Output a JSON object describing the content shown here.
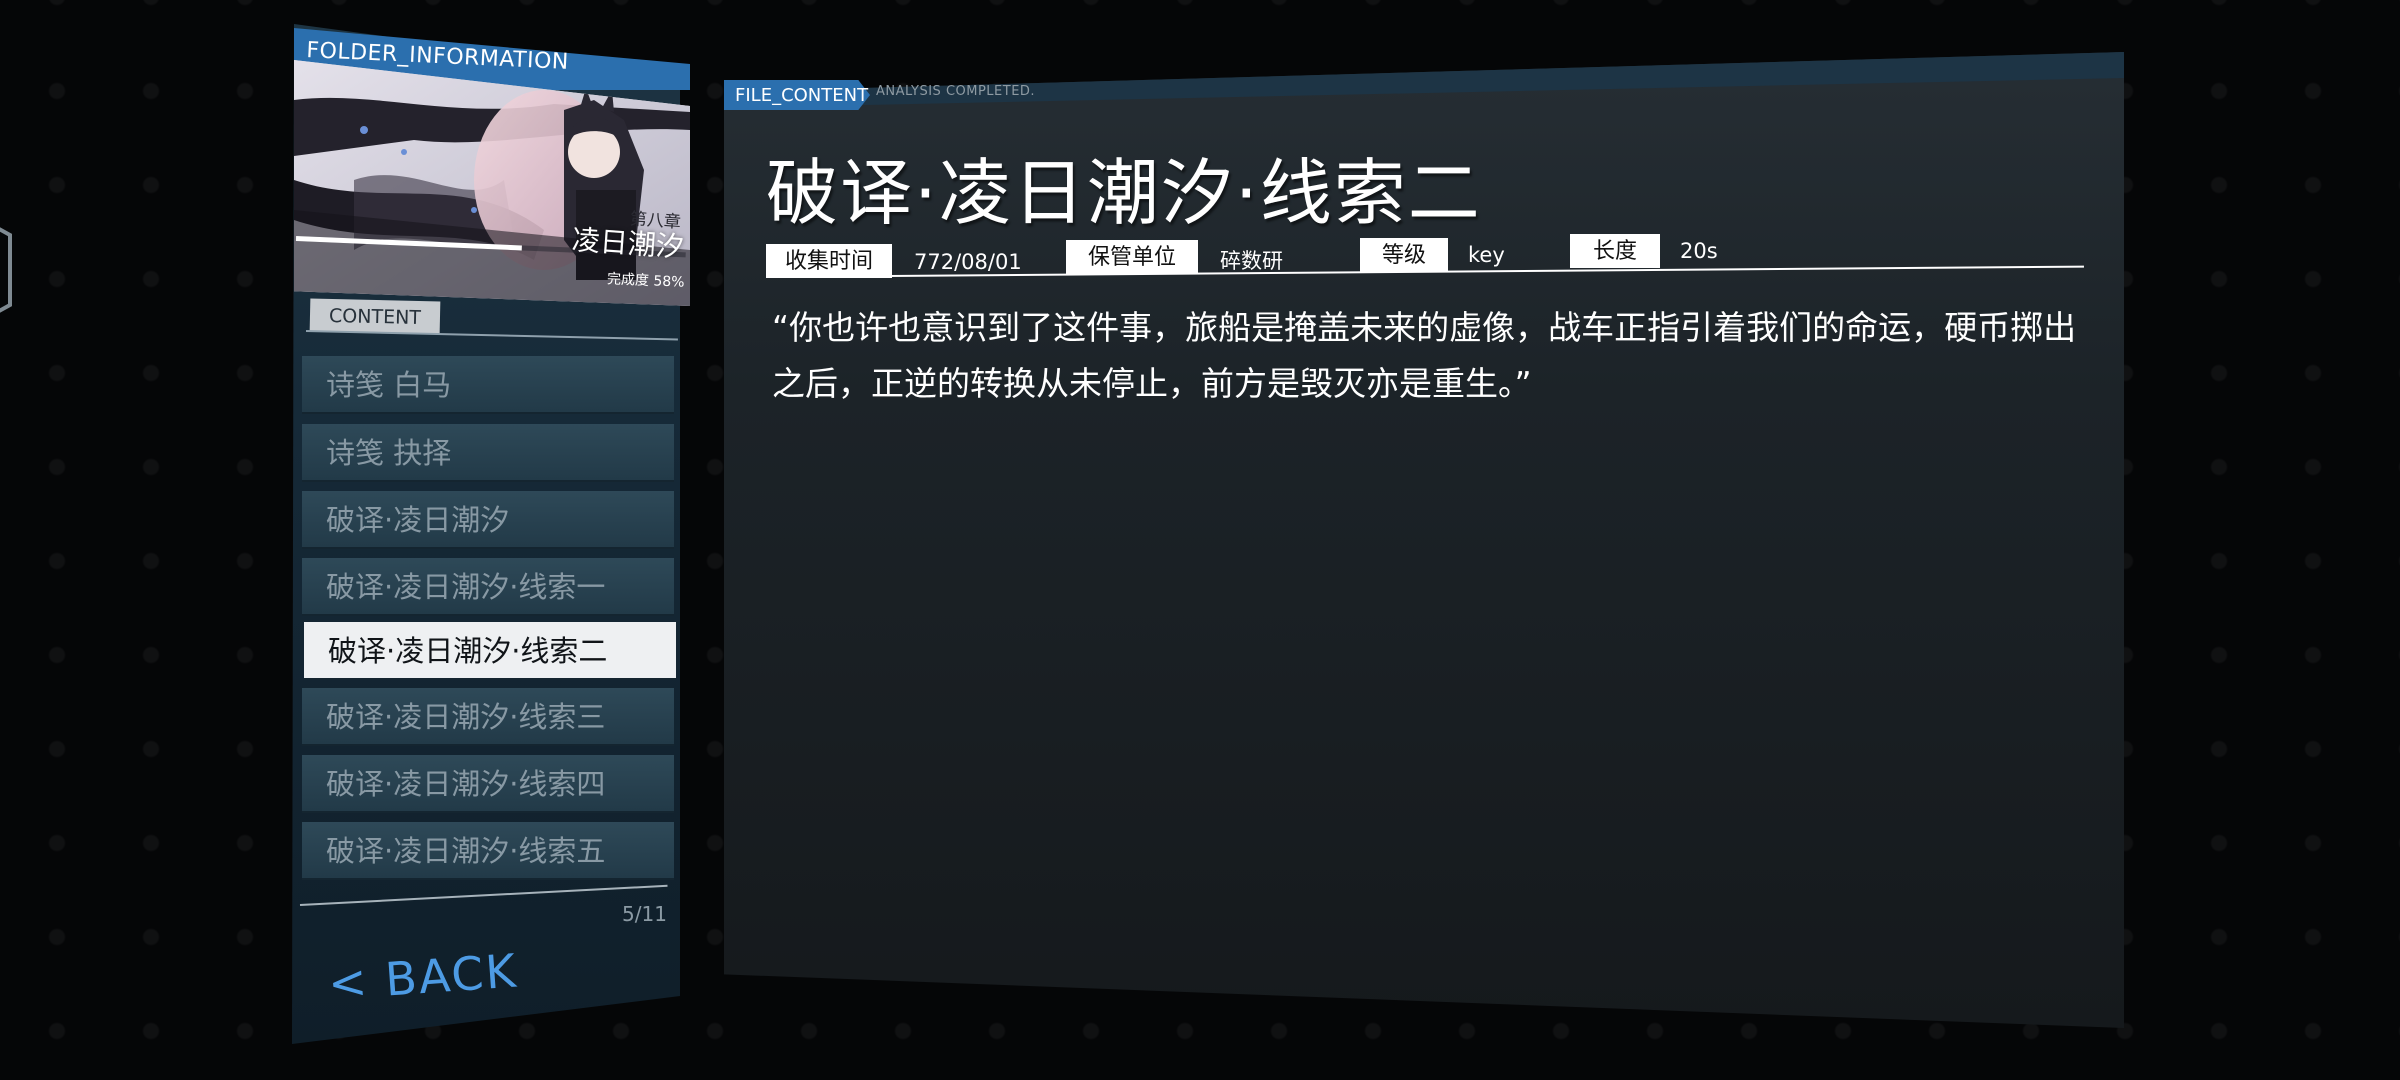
{
  "folder": {
    "title": "FOLDER_INFORMATION",
    "chapter_label": "第八章",
    "chapter_title": "凌日潮汐",
    "progress_text": "完成度 58%",
    "progress": 0.58
  },
  "content_section": {
    "tab_label": "CONTENT",
    "items": [
      {
        "label": "诗笺 白马"
      },
      {
        "label": "诗笺 抉择"
      },
      {
        "label": "破译·凌日潮汐"
      },
      {
        "label": "破译·凌日潮汐·线索一"
      },
      {
        "label": "破译·凌日潮汐·线索二"
      },
      {
        "label": "破译·凌日潮汐·线索三"
      },
      {
        "label": "破译·凌日潮汐·线索四"
      },
      {
        "label": "破译·凌日潮汐·线索五"
      }
    ],
    "selected_index": 4,
    "page_counter": "5/11"
  },
  "back_label": "< BACK",
  "file": {
    "tab_label": "FILE_CONTENT",
    "status": "ANALYSIS COMPLETED.",
    "title": "破译·凌日潮汐·线索二",
    "meta": {
      "collect_time_key": "收集时间",
      "collect_time_val": "772/08/01",
      "custodian_key": "保管单位",
      "custodian_val": "碎数研",
      "level_key": "等级",
      "level_val": "key",
      "length_key": "长度",
      "length_val": "20s"
    },
    "body": "“你也许也意识到了这件事，旅船是掩盖未来的虚像，战车正指引着我们的命运，硬币掷出之后，正逆的转换从未停止，前方是毁灭亦是重生。”"
  },
  "colors": {
    "accent_blue": "#2b6fae",
    "back_blue": "#4d9be4",
    "panel_dark": "#1c2328",
    "selected_bg": "#eef0f2"
  }
}
